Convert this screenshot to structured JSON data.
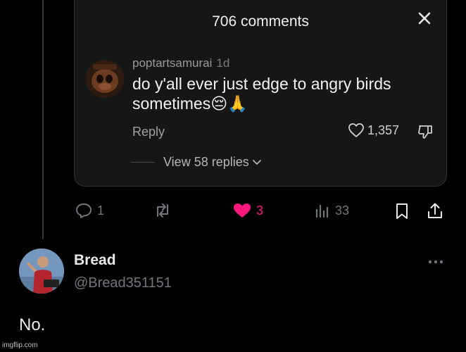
{
  "comments_sheet": {
    "title": "706 comments",
    "comment": {
      "username": "poptartsamurai",
      "age": "1d",
      "text": "do y'all ever just edge to angry birds sometimes😔🙏",
      "reply_label": "Reply",
      "like_count": "1,357"
    },
    "view_replies": "View 58 replies"
  },
  "action_bar": {
    "replies": "1",
    "reposts": "",
    "likes": "3",
    "views": "33"
  },
  "reply_post": {
    "display_name": "Bread",
    "handle": "@Bread351151",
    "text": "No."
  },
  "watermark": "imgflip.com",
  "colors": {
    "background": "#000000",
    "card": "#161616",
    "like_active": "#f91880",
    "muted": "#71767b"
  },
  "icons": [
    "close-icon",
    "heart-outline-icon",
    "dislike-icon",
    "chevron-down-icon",
    "reply-icon",
    "repost-icon",
    "heart-filled-icon",
    "views-icon",
    "bookmark-icon",
    "share-icon",
    "more-icon"
  ]
}
